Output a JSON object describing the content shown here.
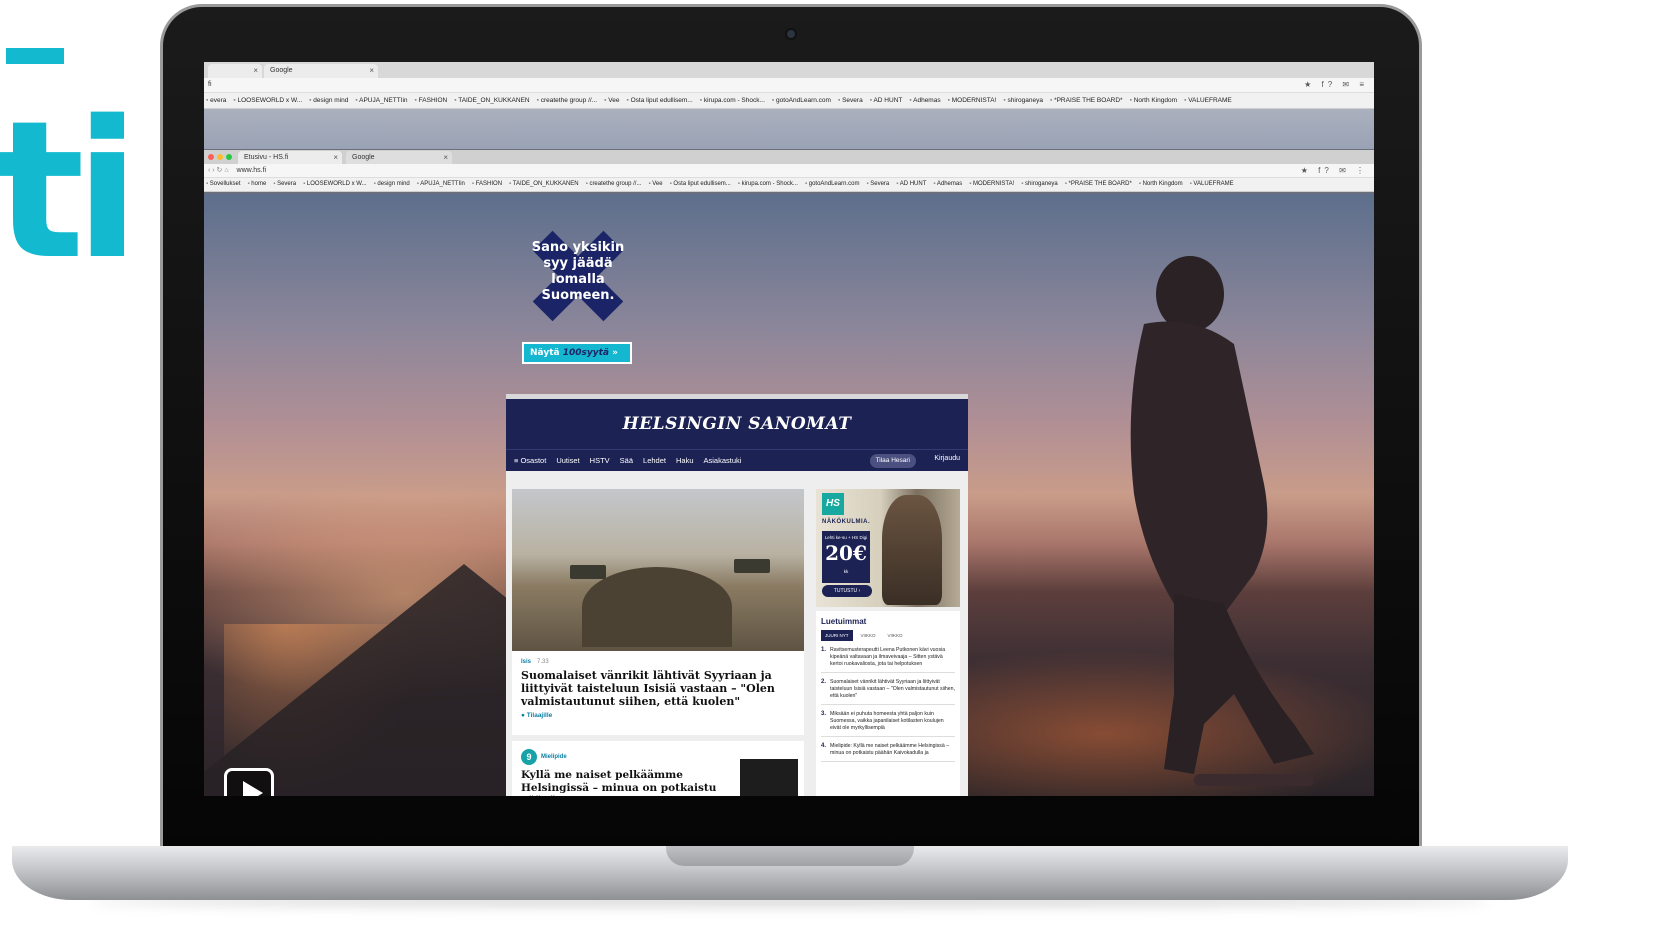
{
  "brand": {
    "letters": "ti",
    "color": "#12b9cf"
  },
  "browser_back": {
    "tabs": [
      {
        "label": "",
        "close": "×"
      },
      {
        "label": "Google",
        "close": "×"
      }
    ],
    "address": "fi",
    "icons": "★ f? ✉ ≡",
    "bookmarks": [
      "evera",
      "LOOSEWORLD x W...",
      "design mind",
      "APUJA_NETTIin",
      "FASHION",
      "TAIDE_ON_KUKKANEN",
      "createthe group //...",
      "Vee",
      "Osta liput edullisem...",
      "kirupa.com - Shock...",
      "gotoAndLearn.com",
      "Severa",
      "AD HUNT",
      "Adhemas",
      "MODERNISTA!",
      "shiroganeya",
      "*PRAISE THE BOARD*",
      "North Kingdom",
      "VALUEFRAME"
    ]
  },
  "browser_front": {
    "tabs": [
      {
        "label": "Etusivu - HS.fi",
        "close": "×"
      },
      {
        "label": "Google",
        "close": "×"
      }
    ],
    "address": "www.hs.fi",
    "icons": "★ f? ✉ ⋮",
    "bookmarks": [
      "Sovellukset",
      "home",
      "Severa",
      "LOOSEWORLD x W...",
      "design mind",
      "APUJA_NETTIin",
      "FASHION",
      "TAIDE_ON_KUKKANEN",
      "createthe group //...",
      "Vee",
      "Osta liput edullisem...",
      "kirupa.com - Shock...",
      "gotoAndLearn.com",
      "Severa",
      "AD HUNT",
      "Adhemas",
      "MODERNISTA!",
      "shiroganeya",
      "*PRAISE THE BOARD*",
      "North Kingdom",
      "VALUEFRAME"
    ]
  },
  "campaign": {
    "slogan_lines": [
      "Sano yksikin",
      "syy jäädä",
      "lomalla",
      "Suomeen."
    ],
    "cta_prefix": "Näytä ",
    "cta_number": "100",
    "cta_suffix": "syytä",
    "cta_arrow": "»"
  },
  "hs": {
    "masthead": "HELSINGIN SANOMAT",
    "nav": [
      "≡ Osastot",
      "Uutiset",
      "HSTV",
      "Sää",
      "Lehdet",
      "Haku",
      "Asiakastuki"
    ],
    "subscribe": "Tilaa Hesari",
    "login": "Kirjaudu",
    "main_story": {
      "kicker": "Isis",
      "time": "7.33",
      "headline": "Suomalaiset vänrikit lähtivät Syyriaan ja liittyivät taisteluun Isisiä vastaan – \"Olen valmistautunut siihen, että kuolen\"",
      "follow": "Tilaajille"
    },
    "second_story": {
      "kicker_icon": "9",
      "kicker": "Mielipide",
      "headline": "Kyllä me naiset pelkäämme Helsingissä – minua on potkaistu päähän Kaivokadulla"
    },
    "ad": {
      "logo": "HS",
      "title": "NÄKÖKULMIA.",
      "small": "Lehti ke-su + HS Digi",
      "price": "20€",
      "price_unit": "kk",
      "button": "TUTUSTU ›"
    },
    "most_read": {
      "title": "Luetuimmat",
      "tabs": [
        "JUURI NYT",
        "VIIKKO",
        "VIIKKO"
      ],
      "items": [
        {
          "num": "1.",
          "text": "Ravitsemusterapeutti Leena Putkonen kävi vuosia kipeänä valtavaan ja ilmaveivaaja – Sitten ystävä kertoi ruokavaliosta, jota tai helpotuksen"
        },
        {
          "num": "2.",
          "text": "Suomalaiset vänrikit lähtivät Syyriaan ja liittyivät taisteluun Isisiä vastaan – \"Olen valmistautunut siihen, että kuolen\""
        },
        {
          "num": "3.",
          "text": "Miksään ei puhuta homeesta yhtä paljon kuin Suomessa, vaikka japanilaiset kotilasten koulujen eivät ole myrkyllisempiä"
        },
        {
          "num": "4.",
          "text": "Mielipide: Kyllä me naiset pelkäämme Helsingissä – minua on potkaistu päähän Kaivokadulla ja"
        }
      ]
    }
  },
  "player": {
    "icon": "play-icon"
  }
}
